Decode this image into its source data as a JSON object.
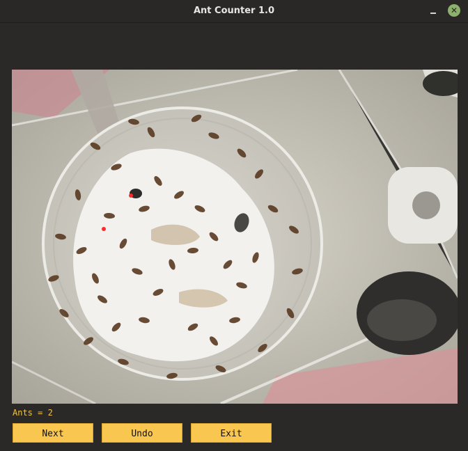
{
  "window": {
    "title": "Ant Counter 1.0",
    "close_glyph": "✕"
  },
  "image": {
    "description_icon": "ant-container-photo",
    "marks_color": "#ff2a2a"
  },
  "status": {
    "text": "Ants = 2"
  },
  "buttons": {
    "next": "Next",
    "undo": "Undo",
    "exit": "Exit"
  },
  "colors": {
    "button_bg": "#f9c74f",
    "status_text": "#f5c542",
    "close_button": "#8db16c"
  }
}
